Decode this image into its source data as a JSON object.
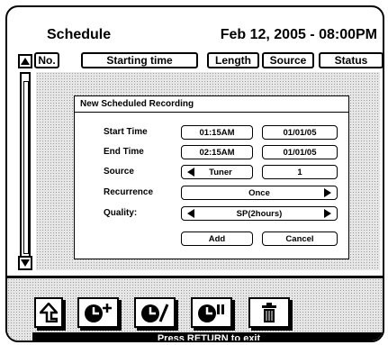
{
  "header": {
    "title": "Schedule",
    "datetime": "Feb 12, 2005 - 08:00PM"
  },
  "columns": [
    {
      "label": "No."
    },
    {
      "label": "Starting time"
    },
    {
      "label": "Length"
    },
    {
      "label": "Source"
    },
    {
      "label": "Status"
    }
  ],
  "dialog": {
    "title": "New Scheduled Recording",
    "start_time": {
      "label": "Start Time",
      "time": "01:15AM",
      "date": "01/01/05"
    },
    "end_time": {
      "label": "End Time",
      "time": "02:15AM",
      "date": "01/01/05"
    },
    "source": {
      "label": "Source",
      "value": "Tuner",
      "channel": "1"
    },
    "recurrence": {
      "label": "Recurrence",
      "value": "Once"
    },
    "quality": {
      "label": "Quality:",
      "value": "SP(2hours)"
    },
    "add_label": "Add",
    "cancel_label": "Cancel"
  },
  "toolbar": {
    "items": [
      {
        "icon": "back-arrow-icon"
      },
      {
        "icon": "add-schedule-icon"
      },
      {
        "icon": "edit-schedule-icon"
      },
      {
        "icon": "pause-schedule-icon"
      },
      {
        "icon": "trash-icon"
      }
    ]
  },
  "status_bar": {
    "text": "Press RETURN to exit"
  }
}
